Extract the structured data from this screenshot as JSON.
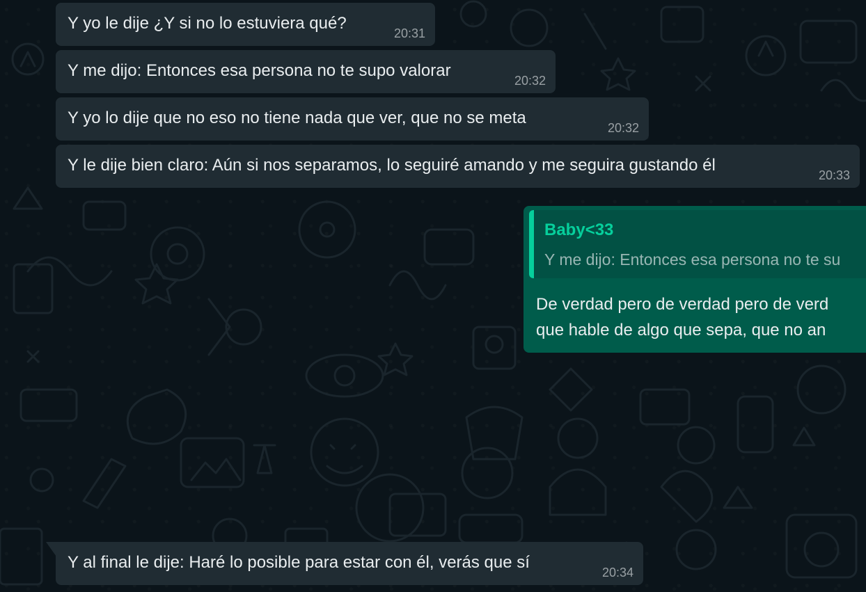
{
  "messages_incoming": [
    {
      "text": "Y yo le dije ¿Y si no lo estuviera qué?",
      "time": "20:31"
    },
    {
      "text": "Y me dijo: Entonces esa persona no te supo valorar",
      "time": "20:32"
    },
    {
      "text": "Y yo lo dije que no eso no tiene nada que ver, que no se meta",
      "time": "20:32"
    },
    {
      "text": "Y le dije bien claro: Aún si nos separamos, lo seguiré amando y me seguira gustando él",
      "time": "20:33"
    }
  ],
  "reply_message": {
    "quoted_author": "Baby<33",
    "quoted_text": "Y me dijo: Entonces esa persona no te su",
    "line1": "De verdad pero de verdad pero de verd",
    "line2": "que hable de algo que sepa, que no an"
  },
  "last_message": {
    "text": "Y al final le dije: Haré lo posible para estar con él, verás que sí",
    "time": "20:34"
  },
  "colors": {
    "background": "#0b141a",
    "incoming_bubble": "#202c33",
    "outgoing_bubble": "#005c4b",
    "quote_accent": "#06cf9c"
  }
}
